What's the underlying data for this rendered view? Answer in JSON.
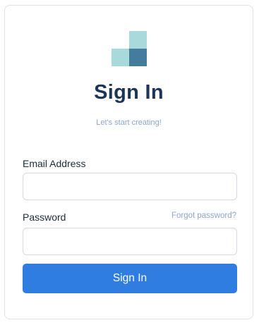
{
  "header": {
    "logo_icon": "stacked-squares-logo",
    "title": "Sign In",
    "subtitle": "Let's start creating!"
  },
  "form": {
    "email_label": "Email Address",
    "email_value": "",
    "email_placeholder": "",
    "password_label": "Password",
    "password_value": "",
    "password_placeholder": "",
    "forgot_link": "Forgot password?",
    "submit_label": "Sign In"
  },
  "colors": {
    "accent": "#2f7de1",
    "title": "#1d3557",
    "muted": "#8fa6c6",
    "logo_light": "#a8dadc",
    "logo_dark": "#457b9d"
  }
}
